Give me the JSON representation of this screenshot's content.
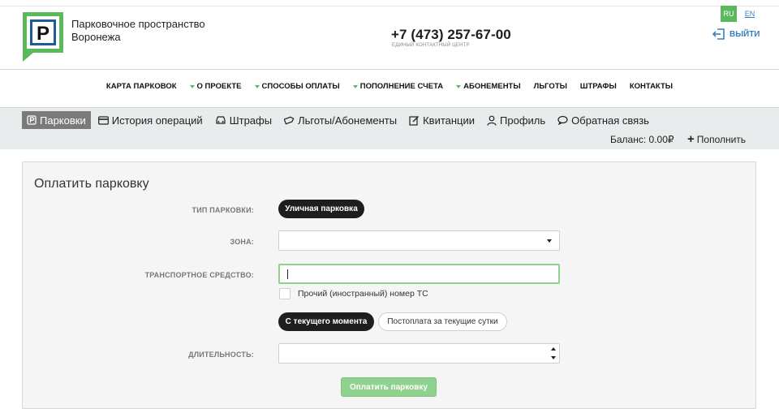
{
  "header": {
    "brand_line1": "Парковочное пространство",
    "brand_line2": "Воронежа",
    "phone": "+7 (473) 257-67-00",
    "phone_caption": "ЕДИНЫЙ КОНТАКТНЫЙ ЦЕНТР",
    "lang_ru": "RU",
    "lang_en": "EN",
    "logout_label": "ВЫЙТИ",
    "logo_letter": "P"
  },
  "main_nav": [
    {
      "label": "КАРТА ПАРКОВОК",
      "dropdown": false
    },
    {
      "label": "О ПРОЕКТЕ",
      "dropdown": true
    },
    {
      "label": "СПОСОБЫ ОПЛАТЫ",
      "dropdown": true
    },
    {
      "label": "ПОПОЛНЕНИЕ СЧЕТА",
      "dropdown": true
    },
    {
      "label": "АБОНЕМЕНТЫ",
      "dropdown": true
    },
    {
      "label": "ЛЬГОТЫ",
      "dropdown": false
    },
    {
      "label": "ШТРАФЫ",
      "dropdown": false
    },
    {
      "label": "КОНТАКТЫ",
      "dropdown": false
    }
  ],
  "user_tabs": [
    {
      "label": "Парковки",
      "icon": "parking-icon",
      "active": true
    },
    {
      "label": "История операций",
      "icon": "card-icon",
      "active": false
    },
    {
      "label": "Штрафы",
      "icon": "car-icon",
      "active": false
    },
    {
      "label": "Льготы/Абонементы",
      "icon": "ticket-icon",
      "active": false
    },
    {
      "label": "Квитанции",
      "icon": "edit-icon",
      "active": false
    },
    {
      "label": "Профиль",
      "icon": "user-icon",
      "active": false
    },
    {
      "label": "Обратная связь",
      "icon": "chat-icon",
      "active": false
    }
  ],
  "balance": {
    "label": "Баланс: 0.00₽",
    "topup_label": "Пополнить"
  },
  "form": {
    "title": "Оплатить парковку",
    "parking_type_label": "ТИП ПАРКОВКИ:",
    "parking_type_value": "Уличная парковка",
    "zone_label": "ЗОНА:",
    "zone_value": "",
    "vehicle_label": "ТРАНСПОРТНОЕ СРЕДСТВО:",
    "vehicle_value": "",
    "foreign_plate_label": "Прочий (иностранный) номер ТС",
    "mode_current": "С текущего момента",
    "mode_postpay": "Постоплата за текущие сутки",
    "duration_label": "ДЛИТЕЛЬНОСТЬ:",
    "duration_value": "",
    "submit_label": "Оплатить парковку"
  },
  "colors": {
    "accent_green": "#5cb85c",
    "link_blue": "#3a7fc2",
    "logo_blue": "#1f5a9a",
    "tab_active_bg": "#7a7a7a",
    "submit_disabled": "#8fd18f"
  }
}
